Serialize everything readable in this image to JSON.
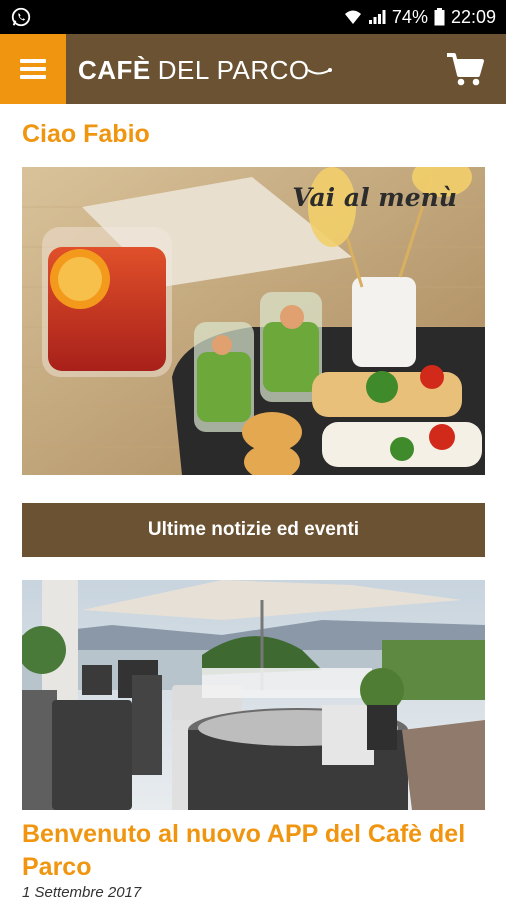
{
  "status_bar": {
    "battery": "74%",
    "time": "22:09",
    "icons": [
      "whatsapp-icon",
      "wifi-icon",
      "signal-icon",
      "battery-icon"
    ]
  },
  "app_bar": {
    "menu_icon": "hamburger-menu-icon",
    "logo_bold": "CAFÈ",
    "logo_light": "DEL PARCO",
    "cart_icon": "shopping-cart-icon",
    "bg_color": "#6a5232",
    "accent_color": "#f0950f"
  },
  "greeting": "Ciao Fabio",
  "hero": {
    "caption": "Vai al menù"
  },
  "news_section": {
    "label": "Ultime notizie ed eventi"
  },
  "article": {
    "title": "Benvenuto al nuovo APP del Cafè del Parco",
    "date": "1 Settembre 2017"
  }
}
